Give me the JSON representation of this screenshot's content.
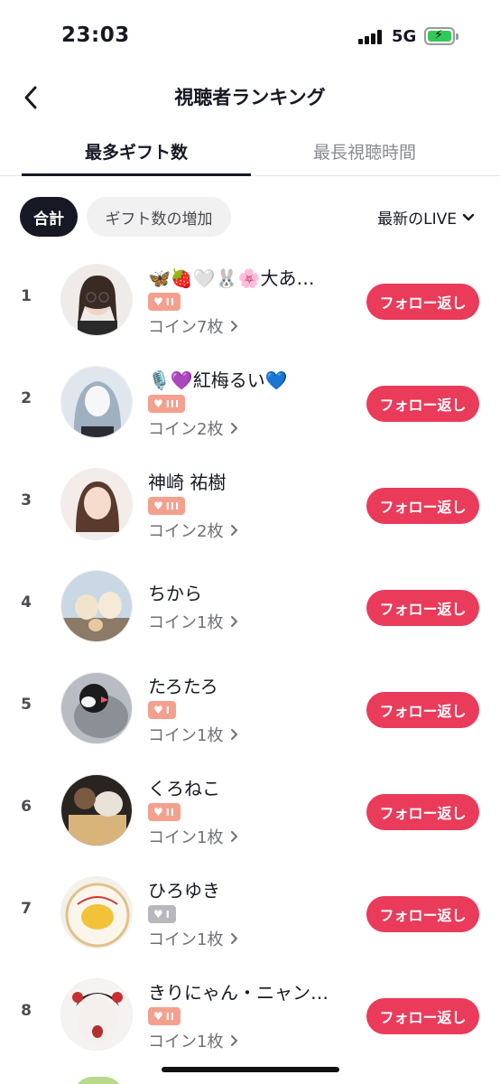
{
  "status_bar": {
    "time": "23:03",
    "network": "5G",
    "battery_color": "#34c759"
  },
  "header": {
    "title": "視聴者ランキング",
    "back_icon": "chevron-left-icon"
  },
  "tabs": [
    {
      "label": "最多ギフト数",
      "active": true
    },
    {
      "label": "最長視聴時間",
      "active": false
    }
  ],
  "filters": {
    "chips": [
      {
        "label": "合計",
        "selected": true
      },
      {
        "label": "ギフト数の増加",
        "selected": false
      }
    ],
    "sort": {
      "label": "最新のLIVE",
      "icon": "chevron-down-icon"
    }
  },
  "colors": {
    "accent": "#ea3b5a",
    "badge": "#f3a18e",
    "badge_gray": "#b8b8bc"
  },
  "viewers": [
    {
      "rank": "1",
      "name": "🦋🍓🤍🐰🌸大あ…",
      "badge_level": "II",
      "badge_color": "orange",
      "coins": "コイン7枚",
      "follow_label": "フォロー返し"
    },
    {
      "rank": "2",
      "name": "🎙️💜紅梅るい💙",
      "badge_level": "III",
      "badge_color": "orange",
      "coins": "コイン2枚",
      "follow_label": "フォロー返し"
    },
    {
      "rank": "3",
      "name": "神崎 祐樹",
      "badge_level": "III",
      "badge_color": "orange",
      "coins": "コイン2枚",
      "follow_label": "フォロー返し"
    },
    {
      "rank": "4",
      "name": "ちから",
      "badge_level": "",
      "badge_color": "none",
      "coins": "コイン1枚",
      "follow_label": "フォロー返し"
    },
    {
      "rank": "5",
      "name": "たろたろ",
      "badge_level": "I",
      "badge_color": "orange",
      "coins": "コイン1枚",
      "follow_label": "フォロー返し"
    },
    {
      "rank": "6",
      "name": "くろねこ",
      "badge_level": "II",
      "badge_color": "orange",
      "coins": "コイン1枚",
      "follow_label": "フォロー返し"
    },
    {
      "rank": "7",
      "name": "ひろゆき",
      "badge_level": "I",
      "badge_color": "gray",
      "coins": "コイン1枚",
      "follow_label": "フォロー返し"
    },
    {
      "rank": "8",
      "name": "きりにゃん・ニャン…",
      "badge_level": "II",
      "badge_color": "orange",
      "coins": "コイン1枚",
      "follow_label": "フォロー返し"
    }
  ]
}
